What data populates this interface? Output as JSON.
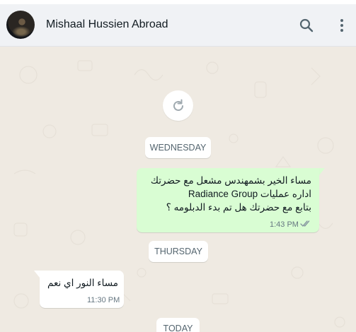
{
  "header": {
    "contact_name": "Mishaal Hussien Abroad",
    "avatar_icon": "contact-avatar",
    "search_icon": "search-icon",
    "menu_icon": "kebab-menu-icon"
  },
  "chat": {
    "refresh_icon": "refresh-icon",
    "date_wednesday": "WEDNESDAY",
    "date_thursday": "THURSDAY",
    "date_today": "TODAY",
    "outgoing": {
      "line1": "مساء الخير بشمهندس مشعل مع حضرتك",
      "line2": "اداره عمليات Radiance Group",
      "line3": "بتابع مع حضرتك هل تم بدء الدبلومه ؟",
      "time": "1:43 PM",
      "status_icon": "double-check-icon"
    },
    "incoming": {
      "text": "مساء النور اي نعم",
      "time": "11:30 PM"
    }
  },
  "colors": {
    "background": "#efeae2",
    "outgoing_bubble": "#d9fdd3",
    "incoming_bubble": "#ffffff",
    "header": "#f0f2f5"
  }
}
